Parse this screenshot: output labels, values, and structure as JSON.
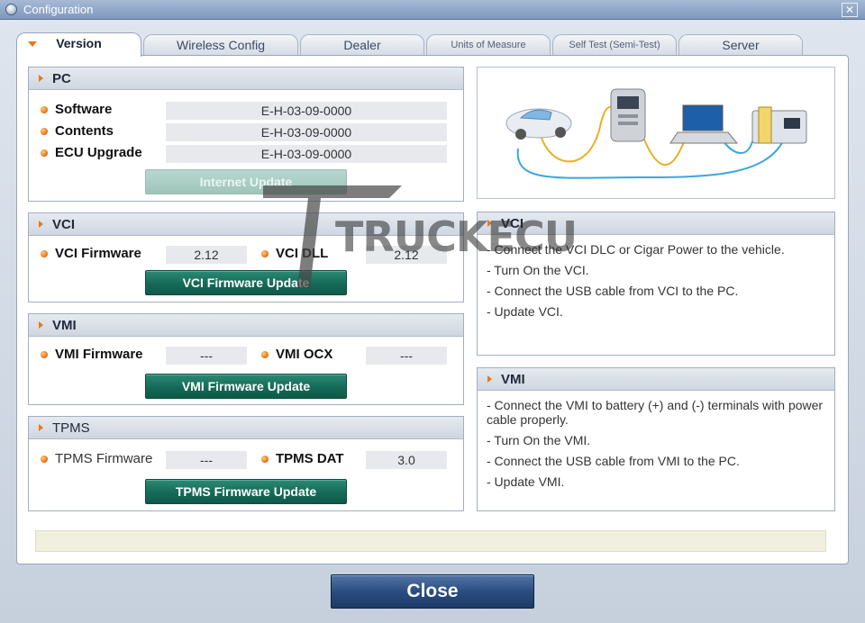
{
  "window": {
    "title": "Configuration",
    "close_glyph": "✕"
  },
  "tabs": [
    {
      "label": "Version",
      "active": true
    },
    {
      "label": "Wireless Config"
    },
    {
      "label": "Dealer"
    },
    {
      "label": "Units of Measure"
    },
    {
      "label": "Self Test (Semi-Test)"
    },
    {
      "label": "Server"
    }
  ],
  "pc": {
    "title": "PC",
    "software_label": "Software",
    "software_value": "E-H-03-09-0000",
    "contents_label": "Contents",
    "contents_value": "E-H-03-09-0000",
    "ecu_label": "ECU Upgrade",
    "ecu_value": "E-H-03-09-0000",
    "update_button": "Internet Update"
  },
  "vci": {
    "title": "VCI",
    "firmware_label": "VCI Firmware",
    "firmware_value": "2.12",
    "dll_label": "VCI DLL",
    "dll_value": "2.12",
    "update_button": "VCI Firmware Update"
  },
  "vmi": {
    "title": "VMI",
    "firmware_label": "VMI Firmware",
    "firmware_value": "---",
    "ocx_label": "VMI OCX",
    "ocx_value": "---",
    "update_button": "VMI Firmware Update"
  },
  "tpms": {
    "title": "TPMS",
    "firmware_label": "TPMS Firmware",
    "firmware_value": "---",
    "dat_label": "TPMS DAT",
    "dat_value": "3.0",
    "update_button": "TPMS Firmware Update"
  },
  "vci_info": {
    "title": "VCI",
    "lines": [
      "- Connect the VCI DLC or Cigar Power to the vehicle.",
      "- Turn On the VCI.",
      "- Connect the USB cable from VCI to the PC.",
      "- Update VCI."
    ]
  },
  "vmi_info": {
    "title": "VMI",
    "lines": [
      "- Connect the VMI to battery (+) and (-) terminals with power cable properly.",
      "- Turn On the VMI.",
      "- Connect the USB cable from VMI to the PC.",
      "- Update VMI."
    ]
  },
  "watermark": "TRUCKECU",
  "close_button": "Close",
  "colors": {
    "accent": "#e67817",
    "button_green": "#156a57",
    "button_blue": "#2b4d80"
  }
}
